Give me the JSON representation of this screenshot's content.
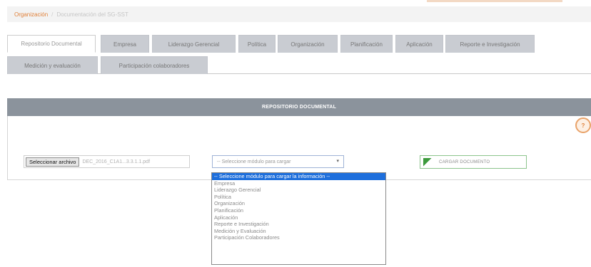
{
  "breadcrumb": {
    "link": "Organización",
    "separator": "/",
    "current": "Documentación del SG-SST"
  },
  "tabs": [
    {
      "label": "Repositorio Documental",
      "active": true
    },
    {
      "label": "Empresa"
    },
    {
      "label": "Liderazgo Gerencial"
    },
    {
      "label": "Política"
    },
    {
      "label": "Organización"
    },
    {
      "label": "Planificación"
    },
    {
      "label": "Aplicación"
    },
    {
      "label": "Reporte e Investigación"
    },
    {
      "label": "Medición y evaluación"
    },
    {
      "label": "Participación colaboradores"
    }
  ],
  "panel": {
    "title": "REPOSITORIO DOCUMENTAL",
    "help_icon": "help-icon",
    "help_symbol": "?"
  },
  "file_input": {
    "button_label": "Seleccionar archivo",
    "file_name": "DEC_2016_C1A1...3.3.1.1.pdf"
  },
  "module_select": {
    "selected_value": "-- Seleccione módulo para cargar",
    "arrow": "▾",
    "options": [
      {
        "label": "-- Seleccione módulo para cargar la información --",
        "selected": true
      },
      {
        "label": "Empresa"
      },
      {
        "label": "Liderazgo Gerencial"
      },
      {
        "label": "Política"
      },
      {
        "label": "Organización"
      },
      {
        "label": "Planificación"
      },
      {
        "label": "Aplicación"
      },
      {
        "label": "Reporte e Investigación"
      },
      {
        "label": "Medición y Evaluación"
      },
      {
        "label": "Participación Colaboradores"
      }
    ]
  },
  "upload_button": {
    "label": "CARGAR DOCUMENTO",
    "icon": "upload-icon",
    "icon_color": "#3c9a3c"
  },
  "colors": {
    "accent": "#e0813a",
    "panel_header": "#8b939c",
    "tab_inactive": "#c9ccd2",
    "selection": "#1e6fdc"
  }
}
